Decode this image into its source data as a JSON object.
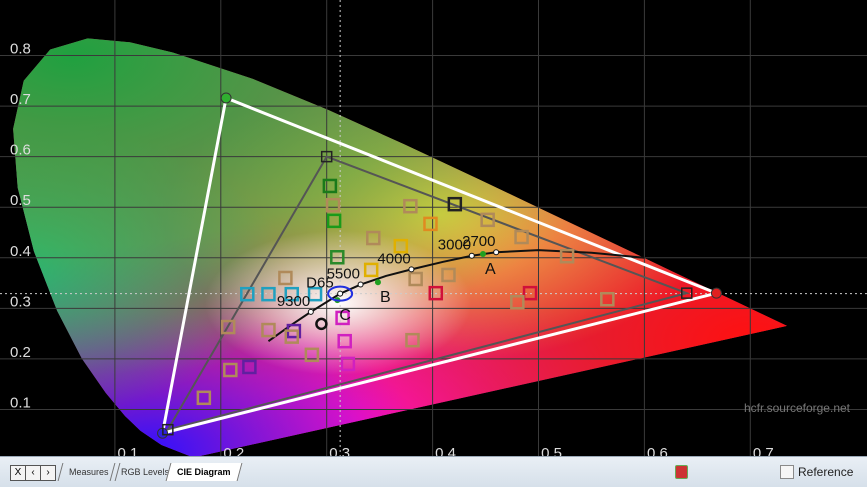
{
  "chart_data": {
    "type": "scatter",
    "title": "",
    "x_ticks": [
      "0.1",
      "0.2",
      "0.3",
      "0.4",
      "0.5",
      "0.6",
      "0.7"
    ],
    "y_ticks": [
      "0.1",
      "0.2",
      "0.3",
      "0.4",
      "0.5",
      "0.6",
      "0.7",
      "0.8"
    ],
    "xlim": [
      0,
      0.8
    ],
    "ylim": [
      0,
      0.9
    ],
    "grid": true,
    "reference_gamut": {
      "red": [
        0.64,
        0.33
      ],
      "green": [
        0.3,
        0.6
      ],
      "blue": [
        0.15,
        0.06
      ]
    },
    "measured_gamut": {
      "red": [
        0.668,
        0.33
      ],
      "green": [
        0.205,
        0.716
      ],
      "blue": [
        0.145,
        0.053
      ]
    },
    "white_point": [
      0.3127,
      0.329
    ],
    "color_temperatures": [
      {
        "label": "9300",
        "x": 0.285,
        "y": 0.293
      },
      {
        "label": "D65",
        "x": 0.3127,
        "y": 0.329
      },
      {
        "label": "5500",
        "x": 0.332,
        "y": 0.347
      },
      {
        "label": "4000",
        "x": 0.38,
        "y": 0.377
      },
      {
        "label": "3000",
        "x": 0.437,
        "y": 0.404
      },
      {
        "label": "2700",
        "x": 0.46,
        "y": 0.411
      }
    ],
    "illuminants": [
      {
        "label": "A",
        "x": 0.4476,
        "y": 0.4074
      },
      {
        "label": "B",
        "x": 0.3484,
        "y": 0.3516
      },
      {
        "label": "C",
        "x": 0.3101,
        "y": 0.3162
      }
    ],
    "measurements": [
      {
        "x": 0.303,
        "y": 0.542,
        "color": "#1a7a1a"
      },
      {
        "x": 0.306,
        "y": 0.504,
        "color": "#b08a5a"
      },
      {
        "x": 0.307,
        "y": 0.473,
        "color": "#1a9a1a"
      },
      {
        "x": 0.31,
        "y": 0.401,
        "color": "#2a8a2a"
      },
      {
        "x": 0.379,
        "y": 0.502,
        "color": "#b08a5a"
      },
      {
        "x": 0.398,
        "y": 0.467,
        "color": "#e08a20"
      },
      {
        "x": 0.421,
        "y": 0.506,
        "color": "#222222"
      },
      {
        "x": 0.452,
        "y": 0.475,
        "color": "#b08a5a"
      },
      {
        "x": 0.484,
        "y": 0.441,
        "color": "#b08a5a"
      },
      {
        "x": 0.527,
        "y": 0.403,
        "color": "#b08a5a"
      },
      {
        "x": 0.344,
        "y": 0.439,
        "color": "#b08a5a"
      },
      {
        "x": 0.37,
        "y": 0.423,
        "color": "#e0b000"
      },
      {
        "x": 0.342,
        "y": 0.376,
        "color": "#e0b000"
      },
      {
        "x": 0.384,
        "y": 0.358,
        "color": "#b08a5a"
      },
      {
        "x": 0.415,
        "y": 0.366,
        "color": "#b08a5a"
      },
      {
        "x": 0.403,
        "y": 0.33,
        "color": "#d0103a"
      },
      {
        "x": 0.492,
        "y": 0.33,
        "color": "#d0103a"
      },
      {
        "x": 0.48,
        "y": 0.312,
        "color": "#b08a5a"
      },
      {
        "x": 0.565,
        "y": 0.318,
        "color": "#b08a5a"
      },
      {
        "x": 0.261,
        "y": 0.36,
        "color": "#b08a5a"
      },
      {
        "x": 0.225,
        "y": 0.328,
        "color": "#20a0c0"
      },
      {
        "x": 0.245,
        "y": 0.328,
        "color": "#20a0c0"
      },
      {
        "x": 0.267,
        "y": 0.328,
        "color": "#20a0c0"
      },
      {
        "x": 0.289,
        "y": 0.328,
        "color": "#20a0c0"
      },
      {
        "x": 0.207,
        "y": 0.263,
        "color": "#b08a5a"
      },
      {
        "x": 0.245,
        "y": 0.257,
        "color": "#b08a5a"
      },
      {
        "x": 0.269,
        "y": 0.255,
        "color": "#6020a0"
      },
      {
        "x": 0.267,
        "y": 0.244,
        "color": "#b08a5a"
      },
      {
        "x": 0.315,
        "y": 0.281,
        "color": "#d020c0"
      },
      {
        "x": 0.317,
        "y": 0.235,
        "color": "#d020c0"
      },
      {
        "x": 0.32,
        "y": 0.19,
        "color": "#d020c0"
      },
      {
        "x": 0.286,
        "y": 0.208,
        "color": "#b08a5a"
      },
      {
        "x": 0.381,
        "y": 0.237,
        "color": "#b08a5a"
      },
      {
        "x": 0.227,
        "y": 0.184,
        "color": "#6020a0"
      },
      {
        "x": 0.209,
        "y": 0.178,
        "color": "#b08a5a"
      },
      {
        "x": 0.184,
        "y": 0.123,
        "color": "#b08a5a"
      }
    ]
  },
  "watermark": "hcfr.sourceforge.net",
  "bottom_bar": {
    "nav": [
      "X",
      "‹",
      "›"
    ],
    "tabs": [
      "Measures",
      "RGB Levels",
      "CIE Diagram"
    ],
    "active_tab": "CIE Diagram",
    "reference_label": "Reference",
    "reference_checked": false
  }
}
